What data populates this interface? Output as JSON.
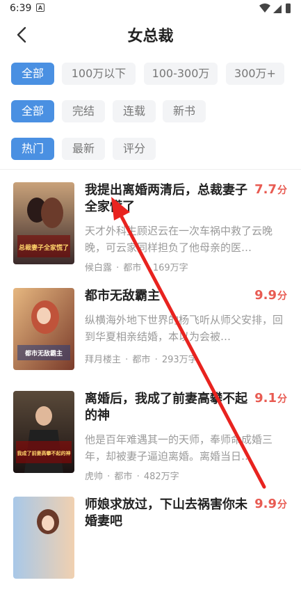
{
  "status": {
    "time": "6:39",
    "notif_letter": "A"
  },
  "header": {
    "title": "女总裁"
  },
  "filters": {
    "wordcount": [
      {
        "label": "全部",
        "active": true
      },
      {
        "label": "100万以下",
        "active": false
      },
      {
        "label": "100-300万",
        "active": false
      },
      {
        "label": "300万+",
        "active": false
      }
    ],
    "status": [
      {
        "label": "全部",
        "active": true
      },
      {
        "label": "完结",
        "active": false
      },
      {
        "label": "连载",
        "active": false
      },
      {
        "label": "新书",
        "active": false
      }
    ],
    "sort": [
      {
        "label": "热门",
        "active": true
      },
      {
        "label": "最新",
        "active": false
      },
      {
        "label": "评分",
        "active": false
      }
    ]
  },
  "books": [
    {
      "title": "我提出离婚两清后，总裁妻子全家慌了",
      "score": "7.7",
      "unit": "分",
      "desc": "天才外科生顾迟云在一次车祸中救了云晚晚，可云家同样担负了他母亲的医…",
      "author": "候白露",
      "category": "都市",
      "words": "169万字",
      "cover_text": "总裁妻子全家慌了"
    },
    {
      "title": "都市无敌霸主",
      "score": "9.9",
      "unit": "分",
      "desc": "纵横海外地下世界的杨飞听从师父安排，回到华夏相亲结婚，本以为会被…",
      "author": "拜月楼主",
      "category": "都市",
      "words": "293万字",
      "cover_text": "都市无敌霸主"
    },
    {
      "title": "离婚后，我成了前妻高攀不起的神",
      "score": "9.1",
      "unit": "分",
      "desc": "他是百年难遇其一的天师，奉师命成婚三年，却被妻子逼迫离婚。离婚当日…",
      "author": "虎帅",
      "category": "都市",
      "words": "482万字",
      "cover_text": "我成了前妻高攀不起的神"
    },
    {
      "title": "师娘求放过，下山去祸害你未婚妻吧",
      "score": "9.9",
      "unit": "分",
      "desc": "",
      "author": "",
      "category": "",
      "words": "",
      "cover_text": ""
    }
  ],
  "meta_separator": " · ",
  "colors": {
    "accent": "#4a90e2",
    "score": "#e85b52",
    "arrow": "#e8231f"
  }
}
